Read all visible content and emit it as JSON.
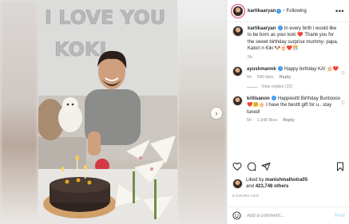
{
  "photo": {
    "balloon_text_line1": "I LOVE YOU",
    "balloon_text_line2": "KOKI"
  },
  "header": {
    "username": "kartikaaryan",
    "follow_label": "Following",
    "more_label": "•••"
  },
  "caption": {
    "username": "kartikaaryan",
    "text": "In every birth i would like to be born as your koki ❤️ Thank you for the sweet birthday surprise mummy- papa, Katori n Kiki 🐶🎂❤️🎊",
    "time": "5h"
  },
  "comments": [
    {
      "username": "ayushmannk",
      "text": "Happy birthday KA! 🎂❤️",
      "time": "5h",
      "likes": "540 likes",
      "reply_label": "Reply",
      "view_replies": "View replies (22)"
    },
    {
      "username": "kritisanon",
      "text": "Happiesttt Birthday Buntoooo❤️🤗🎂 I have the besttt gift for u.. stay tuned!",
      "time": "5h",
      "likes": "1,048 likes",
      "reply_label": "Reply"
    }
  ],
  "likes": {
    "prefix": "Liked by",
    "user": "manishmalhotra05",
    "mid": "and",
    "count": "423,748 others"
  },
  "timestamp": "5 HOURS AGO",
  "add_comment": {
    "placeholder": "Add a comment...",
    "post_label": "Post"
  },
  "colors": {
    "verified": "#3897f0",
    "story_ring": "#e0417e",
    "post_disabled": "#b2dffc"
  }
}
